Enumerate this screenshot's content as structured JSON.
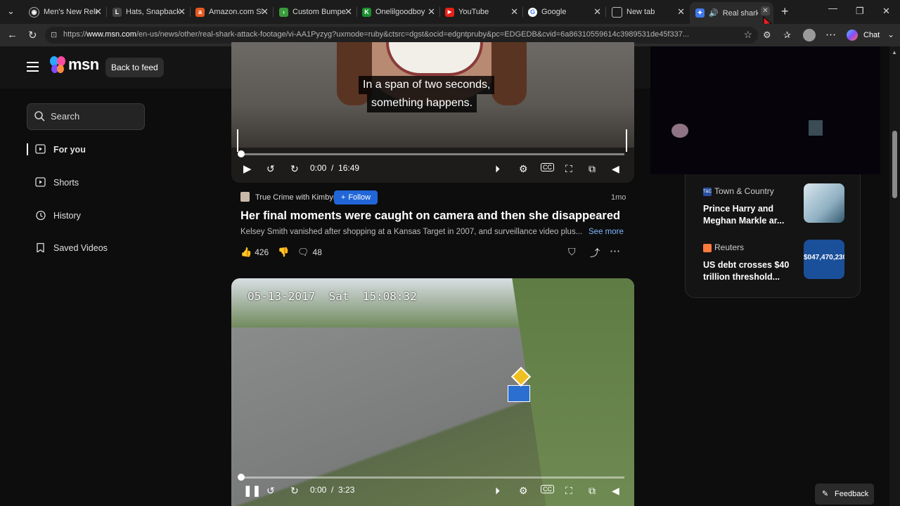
{
  "tabs": [
    {
      "title": "Men's New Rele",
      "fav_color": "#222222",
      "fav_glyph": "◉"
    },
    {
      "title": "Hats, Snapback",
      "fav_color": "#333333",
      "fav_glyph": "L"
    },
    {
      "title": "Amazon.com Sh",
      "fav_color": "#e65a22",
      "fav_glyph": "a"
    },
    {
      "title": "Custom Bumper",
      "fav_color": "#3a9a3a",
      "fav_glyph": "›"
    },
    {
      "title": "Onelilgoodboy",
      "fav_color": "#1b8f2e",
      "fav_glyph": "K"
    },
    {
      "title": "YouTube",
      "fav_color": "#e62117",
      "fav_glyph": "▶"
    },
    {
      "title": "Google",
      "fav_color": "#ffffff",
      "fav_glyph": "G"
    },
    {
      "title": "New tab",
      "fav_color": "#3a3a3a",
      "fav_glyph": "□"
    },
    {
      "title": "Real shark",
      "fav_color": "#4a8cf7",
      "fav_glyph": "✦"
    }
  ],
  "address": {
    "prefix": "https://",
    "host": "www.msn.com",
    "path": "/en-us/news/other/real-shark-attack-footage/vi-AA1Pyzyg?uxmode=ruby&ctsrc=dgst&ocid=edgntpruby&pc=EDGEDB&cvid=6a86310559614c3989531de45f337..."
  },
  "toolbar": {
    "chat_label": "Chat"
  },
  "header": {
    "logo_text": "msn",
    "back_label": "Back to feed"
  },
  "sidebar": {
    "search_placeholder": "Search",
    "items": [
      {
        "label": "For you",
        "icon": "play-square-icon"
      },
      {
        "label": "Shorts",
        "icon": "shorts-icon"
      },
      {
        "label": "History",
        "icon": "history-icon"
      },
      {
        "label": "Saved Videos",
        "icon": "bookmark-icon"
      }
    ]
  },
  "video1": {
    "caption_line1": "In a span of two seconds,",
    "caption_line2": "something happens.",
    "time": "0:00  /  16:49",
    "progress": 0
  },
  "article": {
    "source": "True Crime with Kimbyr",
    "follow_label": "Follow",
    "age": "1mo",
    "title": "Her final moments were caught on camera and then she disappeared",
    "desc": "Kelsey Smith vanished after shopping at a Kansas Target in 2007, and surveillance video plus...",
    "see_more": "See more",
    "likes": "426",
    "comments": "48"
  },
  "video2": {
    "overlay": "05-13-2017  Sat  15:08:32",
    "time": "0:00  /  3:23",
    "progress": 0
  },
  "right_rail": [
    {
      "source": "Town & Country",
      "title": "Prince Harry and Meghan Markle ar...",
      "thumb_color": "#b4cad6"
    },
    {
      "source": "Reuters",
      "title": "US debt crosses $40 trillion threshold...",
      "thumb_text": "$047,470,230",
      "thumb_color": "#1a4f9a"
    }
  ],
  "feedback_label": "Feedback",
  "colors": {
    "accent": "#2166d8",
    "background": "#0d0d0d"
  }
}
